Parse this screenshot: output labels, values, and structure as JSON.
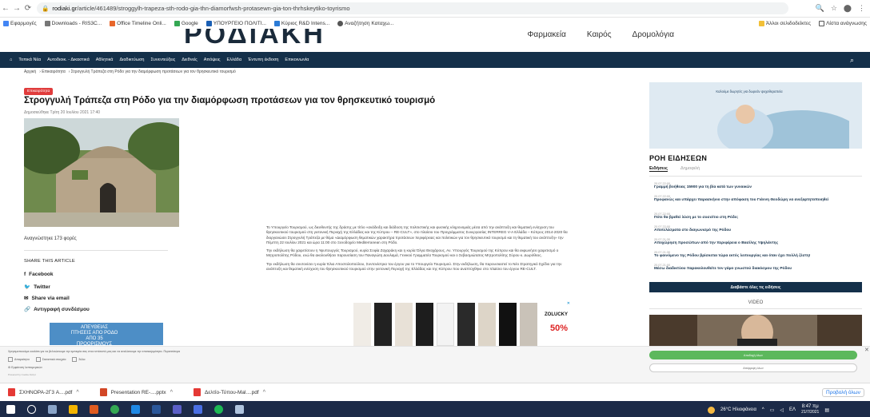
{
  "browser": {
    "url_domain": "rodiaki.gr",
    "url_path": "/article/461489/stroggylh-trapeza-sth-rodo-gia-thn-diamorfwsh-protasewn-gia-ton-thrhskeytiko-toyrismo",
    "bookmarks": [
      "Εφαρμογές",
      "Downloads - RIS3C...",
      "Office Timeline Onli...",
      "Google",
      "ΥΠΟΥΡΓΕΙΟ ΠΟΛΙΤΙ...",
      "Κύριος R&D Intens...",
      "Αναζήτηση Καταχω..."
    ],
    "bookmarks_right": [
      "Άλλοι σελιδοδείκτες",
      "Λίστα ανάγνωσης"
    ]
  },
  "site": {
    "logo": "ΡΟΔΙΑΚΗ",
    "header_links": [
      "Φαρμακεία",
      "Καιρός",
      "Δρομολόγια"
    ],
    "nav": [
      "Τοπικά Νέα",
      "Αυτοδιοικ. - Δικαστικά",
      "Αθλητικά",
      "Διαδικτύωση",
      "Συνεντεύξεις",
      "Διεθνείς",
      "Απόψεις",
      "Ελλάδα",
      "Έντυπη έκδοση",
      "Επικοινωνία"
    ],
    "breadcrumb": [
      "Αρχική",
      "Επικαιρότητα",
      "Στρογγυλή Τράπεζα στη Ρόδο για την διαμόρφωση προτάσεων για τον θρησκευτικό τουρισμό"
    ]
  },
  "article": {
    "category": "Επικαιρότητα",
    "title": "Στρογγυλή Τράπεζα στη Ρόδο για την διαμόρφωση προτάσεων για τον θρησκευτικό τουρισμό",
    "date": "Δημοσιεύθηκε Τρίτη 20 Ιουλίου 2021 17:40",
    "reads": "Αναγνώστηκε 173 φορές",
    "share_title": "SHARE THIS ARTICLE",
    "share_links": [
      "Facebook",
      "Twitter",
      "Share via email",
      "Αντιγραφή συνδέσμου"
    ],
    "paragraphs": [
      "Το Υπουργείο Τουρισμού, ως διευθυντής της δράσης με τίτλο «ανάδειξη και διάδοση της πολιτιστικής και φυσικής κληρονομιάς μέσα από την ανάπτυξη και θεματική ενίσχυση του θρησκευτικού τουρισμού στη γειτονική Περιοχή της Ελλάδας και της Κύπρου – RE-CULT», στο πλαίσιο του Προγράμματος Συνεργασίας INTERREG V-A Ελλάδα – Κύπρος 2014-2020 θα διοργανώσει Στρογγυλή Τράπεζα με θέμα «Διαμόρφωση θεματικών χαρακτήρα προτάσεων περιφέρειας και πολιτικών για τον θρησκευτικό τουρισμό και τη θεματική του ανάπτυξη» την Πέμπτη 22 Ιουλίου 2021 και ώρα 11:00 στο Ξενοδοχείο Mediterranean στη Ρόδο.",
      "Την εκδήλωση θα χαιρετίσουν η Υφυπουργός Τουρισμού, κυρία Σοφία Ζαχαράκη και η κυρία Όλγα Θεοχάρους, Αν. Υπουργός Τουρισμού της Κύπρου και θα εκφωνήσει χαιρετισμό ο Μητροπολίτης Ρόδου, ενώ θα ακολουθήσει παρουσίαση του Παναγιώτη Δουλαμά, Γενικού Γραμματέα Τουρισμού και ο Σεβασμιώτατος Μητροπολίτης Σύρου κ. Δωρόθεος.",
      "Την εκδήλωση θα συντονίσει η κυρία Έλια Αποστολοπούλου, Συντονίστρια του έργου για το Υπουργείο Τουρισμού. Στην εκδήλωση, θα παρουσιαστεί το Νέο Στρατηγικό Σχέδιο για την ανάπτυξη και θεματική ενίσχυση του θρησκευτικού τουρισμού στην γειτονική Περιοχή της Ελλάδας και της Κύπρου που αναπτύχθηκε στο πλαίσιο του έργου RE-CULT."
    ],
    "ad_left": "ΑΠΕΥΘΕΙΑΣ ΠΤΗΣΕΙΣ ΑΠΟ ΡΟΔΟ ΑΠΟ 35 ΠΡΟΟΡΙΣΜΟΥΣ",
    "ad_bottom_brand": "ZOLUCKY",
    "ad_bottom_offer": "50%"
  },
  "sidebar": {
    "ad_text": "Καλούμε δωρητές για δωρεάν ψυχοθεραπεία",
    "feed_title": "ΡΟΗ ΕΙΔΗΣΕΩΝ",
    "tabs": [
      "Ειδήσεις",
      "Δημοφιλή"
    ],
    "news": [
      {
        "time": "20.07.22:00",
        "text": "Γραμμή βοήθειας 15900 για τη βία κατά των γυναικών"
      },
      {
        "time": "20.07.22:00",
        "text": "Προφανώς και υπάρχει παρασκήνιο στην απόφαση του Γιάννη Θεοδώρη να ανεξαρτητοποιηθεί"
      },
      {
        "time": "20.07.22:00",
        "text": "Πότε θα βρεθεί λύση με το συσσίτιο στη Ρόδο;"
      },
      {
        "time": "20.07.22:00",
        "text": "Αποτελέσματα στο διαγωνισμό της Ρόδου"
      },
      {
        "time": "20.07.21:30",
        "text": "Αποχώρηση προσώπων από την περιφέρεια ο Βασίλης Υψηλάντης"
      },
      {
        "time": "20.07.21:30",
        "text": "Το φαινόμενο της Ρόδου βρίσκεται τώρα εκτός λειτουργίας και όταν έχει πολλή ζέστη!"
      },
      {
        "time": "20.07.21:00",
        "text": "Μέσω διαδικτύου παρακολουθείτε τον γάμο γνωστού διακόσμου της Ρόδου"
      }
    ],
    "all_news": "Διαβάστε όλες τις ειδήσεις",
    "video_title": "VIDEO"
  },
  "cookie": {
    "text": "Χρησιμοποιούμε cookies για να βελτιώσουμε την εμπειρία σας στον ιστότοπό μας και να αναλύσουμε την επισκεψιμότητα. Περισσότερα",
    "checks": [
      "Απαραίτητα",
      "Στατιστικά στοιχεία",
      "Άλλα"
    ],
    "details": "Εμφάνιση λεπτομερειών",
    "powered": "Powered by Cookie-Script",
    "accept": "Αποδοχή όλων",
    "decline": "Απόρριψη όλων"
  },
  "downloads": [
    "ΣΧΗΝΟΡΑ-2Γ3 A....pdf",
    "Presentation RE-....pptx",
    "Δελτίο-Τύπου-Mal....pdf"
  ],
  "downloads_show_all": "Προβολή όλων",
  "taskbar": {
    "weather": "26°C Ηλιοφάνεια",
    "lang": "ΕΛ",
    "time": "8:47 πμ",
    "date": "21/7/2021"
  }
}
